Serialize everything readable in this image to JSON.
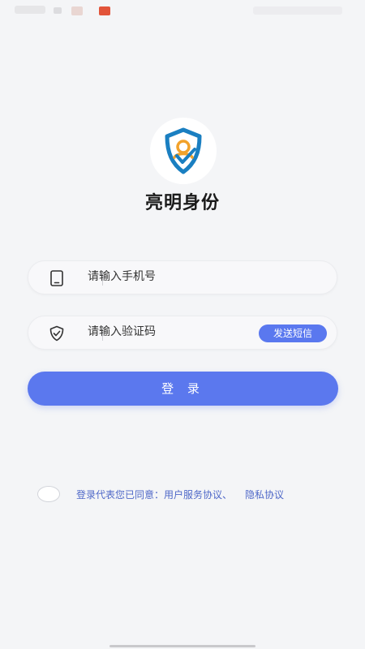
{
  "app": {
    "title": "亮明身份"
  },
  "phone_field": {
    "placeholder": "请输入手机号"
  },
  "code_field": {
    "placeholder": "请输入验证码",
    "send_sms_label": "发送短信"
  },
  "login_button": {
    "label": "登 录"
  },
  "agreement": {
    "prefix": "登录代表您已同意：",
    "user_agreement": "用户服务协议、",
    "privacy_policy": "隐私协议"
  },
  "colors": {
    "accent": "#5b78ee",
    "background": "#f4f5f7",
    "link": "#4f68c8",
    "logo_blue": "#1a7fc1",
    "logo_orange": "#f2a22b"
  },
  "icons": {
    "logo": "shield-person-check-icon",
    "phone": "phone-icon",
    "code": "shield-check-icon"
  }
}
